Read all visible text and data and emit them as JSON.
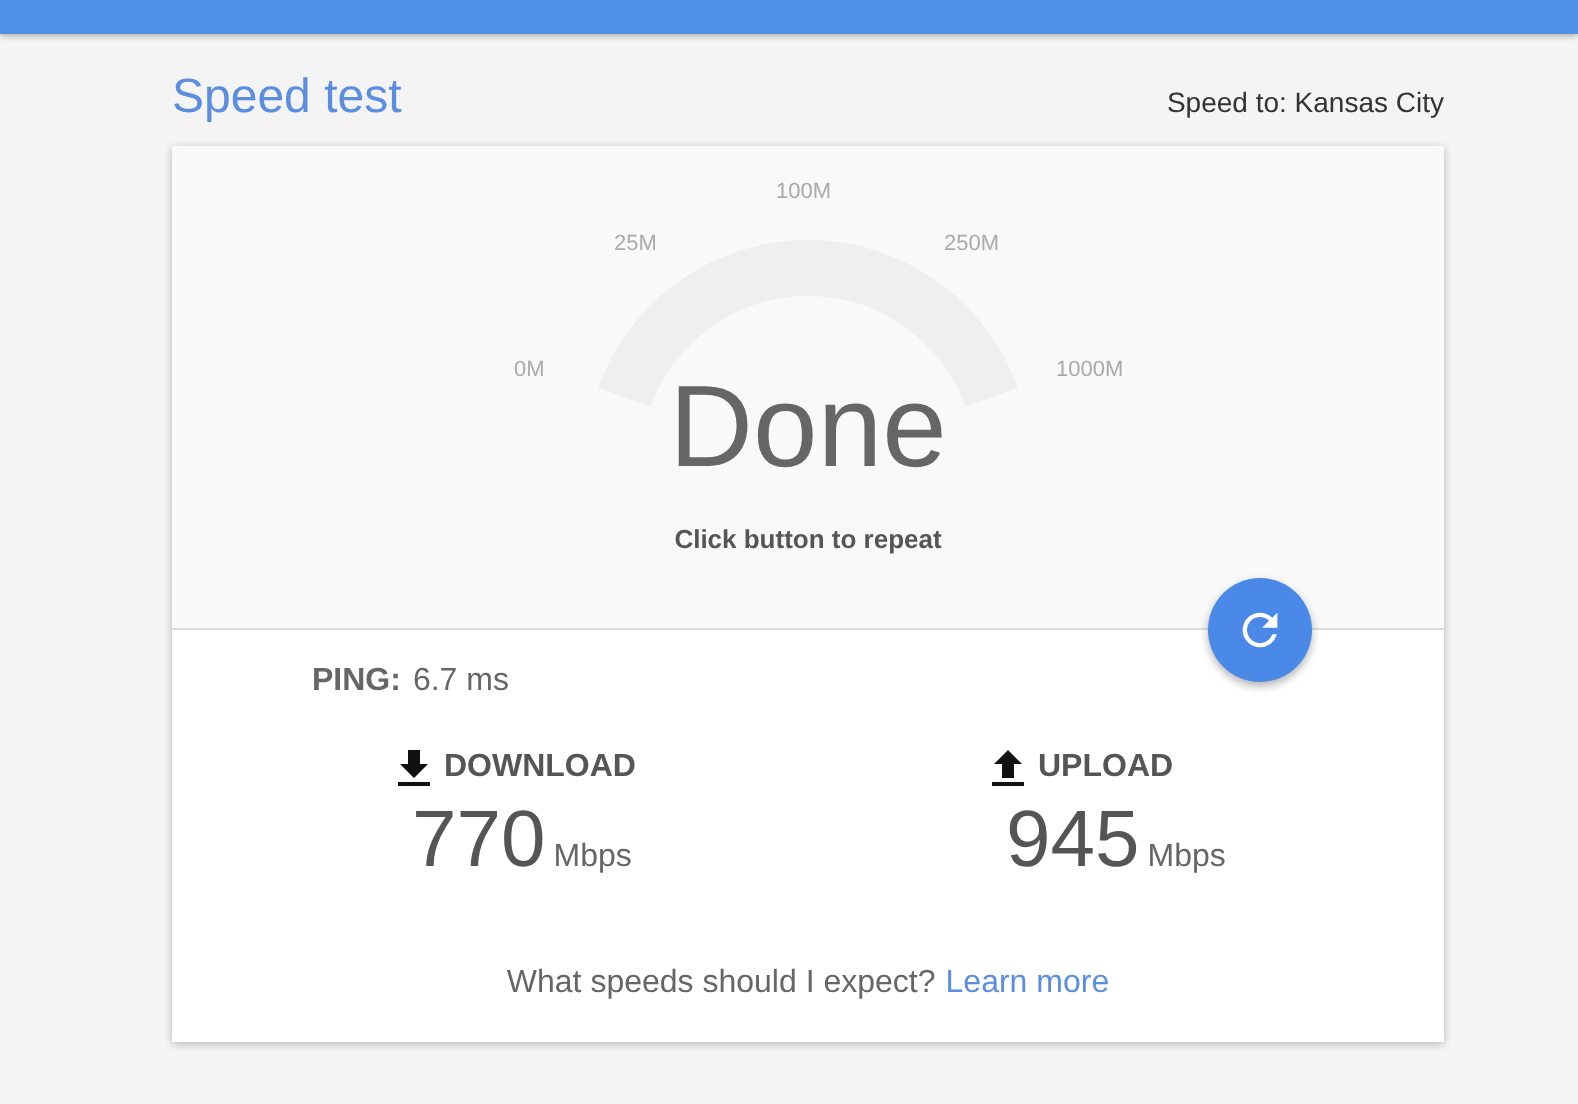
{
  "header": {
    "title": "Speed test",
    "server": "Speed to: Kansas City"
  },
  "gauge": {
    "ticks": [
      "0M",
      "25M",
      "100M",
      "250M",
      "1000M"
    ],
    "status": "Done",
    "hint": "Click button to repeat"
  },
  "ping": {
    "label": "PING:",
    "value": "6.7 ms"
  },
  "metrics": [
    {
      "kind": "download",
      "label": "DOWNLOAD",
      "value": "770",
      "unit": "Mbps"
    },
    {
      "kind": "upload",
      "label": "UPLOAD",
      "value": "945",
      "unit": "Mbps"
    }
  ],
  "footer": {
    "text": "What speeds should I expect?",
    "link": "Learn more"
  }
}
